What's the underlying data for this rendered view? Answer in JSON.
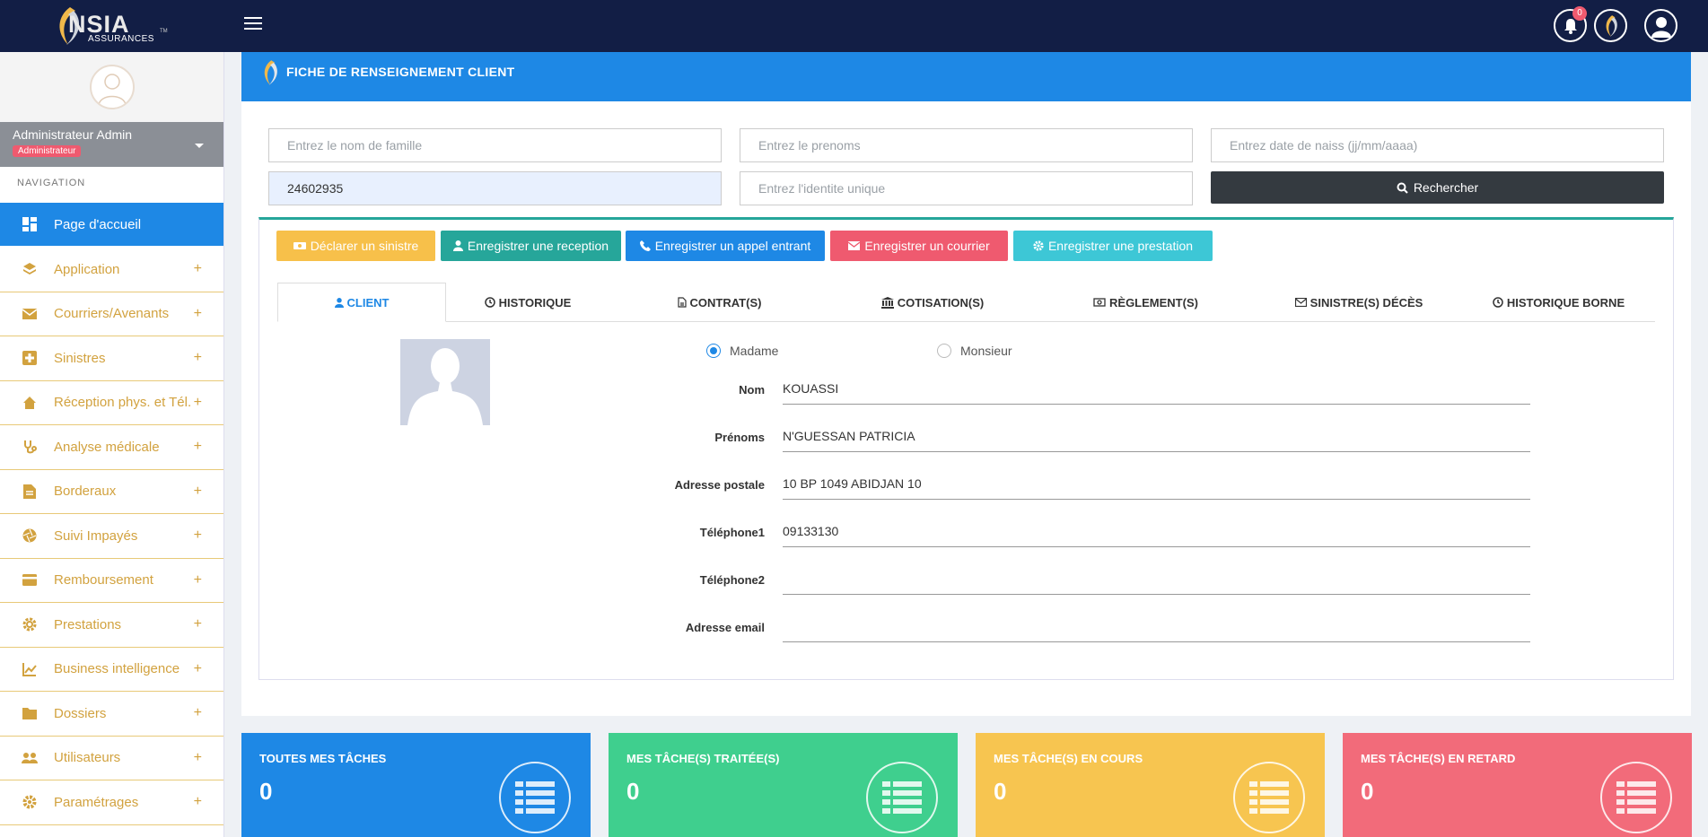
{
  "brand": {
    "name": "NSIA",
    "subtitle": "ASSURANCES",
    "tm": "TM"
  },
  "topbar": {
    "notification_count": "0"
  },
  "sidebar": {
    "user_name": "Administrateur Admin",
    "user_role": "Administrateur",
    "nav_title": "NAVIGATION",
    "items": [
      {
        "label": "Page d'accueil",
        "icon": "dashboard-icon",
        "active": true
      },
      {
        "label": "Application",
        "icon": "layers-icon"
      },
      {
        "label": "Courriers/Avenants",
        "icon": "mail-icon"
      },
      {
        "label": "Sinistres",
        "icon": "medical-cross-icon"
      },
      {
        "label": "Réception phys. et Tél.",
        "icon": "home-icon"
      },
      {
        "label": "Analyse médicale",
        "icon": "stethoscope-icon"
      },
      {
        "label": "Borderaux",
        "icon": "document-icon"
      },
      {
        "label": "Suivi Impayés",
        "icon": "aperture-icon"
      },
      {
        "label": "Remboursement",
        "icon": "credit-card-icon"
      },
      {
        "label": "Prestations",
        "icon": "gear-icon"
      },
      {
        "label": "Business intelligence",
        "icon": "chart-icon"
      },
      {
        "label": "Dossiers",
        "icon": "folder-icon"
      },
      {
        "label": "Utilisateurs",
        "icon": "users-icon"
      },
      {
        "label": "Paramétrages",
        "icon": "settings-icon"
      }
    ],
    "plus": "+"
  },
  "header": {
    "title": "FICHE DE RENSEIGNEMENT CLIENT"
  },
  "search": {
    "nom_placeholder": "Entrez le nom de famille",
    "prenoms_placeholder": "Entrez le prenoms",
    "date_placeholder": "Entrez date de naiss (jj/mm/aaaa)",
    "police_value": "24602935",
    "identite_placeholder": "Entrez l'identite unique",
    "button": "Rechercher"
  },
  "actions": [
    {
      "label": "Déclarer un sinistre",
      "color": "#f7c04a"
    },
    {
      "label": "Enregistrer une reception",
      "color": "#26a69a"
    },
    {
      "label": "Enregistrer un appel entrant",
      "color": "#1e88e5"
    },
    {
      "label": "Enregistrer un courrier",
      "color": "#ef5a6f"
    },
    {
      "label": "Enregistrer une prestation",
      "color": "#3dc7d6"
    }
  ],
  "tabs": [
    {
      "label": "CLIENT",
      "active": true
    },
    {
      "label": "HISTORIQUE"
    },
    {
      "label": "CONTRAT(S)"
    },
    {
      "label": "COTISATION(S)"
    },
    {
      "label": "RÈGLEMENT(S)"
    },
    {
      "label": "SINISTRE(S) DÉCÈS"
    },
    {
      "label": "HISTORIQUE BORNE"
    }
  ],
  "client": {
    "civilite_options": [
      "Madame",
      "Monsieur"
    ],
    "civilite_selected": "Madame",
    "fields": [
      {
        "label": "Nom",
        "value": "KOUASSI"
      },
      {
        "label": "Prénoms",
        "value": "N'GUESSAN PATRICIA"
      },
      {
        "label": "Adresse postale",
        "value": "10 BP 1049 ABIDJAN 10"
      },
      {
        "label": "Téléphone1",
        "value": "09133130"
      },
      {
        "label": "Téléphone2",
        "value": ""
      },
      {
        "label": "Adresse email",
        "value": ""
      }
    ]
  },
  "tiles": [
    {
      "title": "TOUTES MES TÂCHES",
      "count": "0",
      "color": "#1e88e5"
    },
    {
      "title": "MES TÂCHE(S) TRAITÉE(S)",
      "count": "0",
      "color": "#3fcf8e"
    },
    {
      "title": "MES TÂCHE(S) EN COURS",
      "count": "0",
      "color": "#f7c550"
    },
    {
      "title": "MES TÂCHE(S) EN RETARD",
      "count": "0",
      "color": "#f26b7a"
    }
  ]
}
